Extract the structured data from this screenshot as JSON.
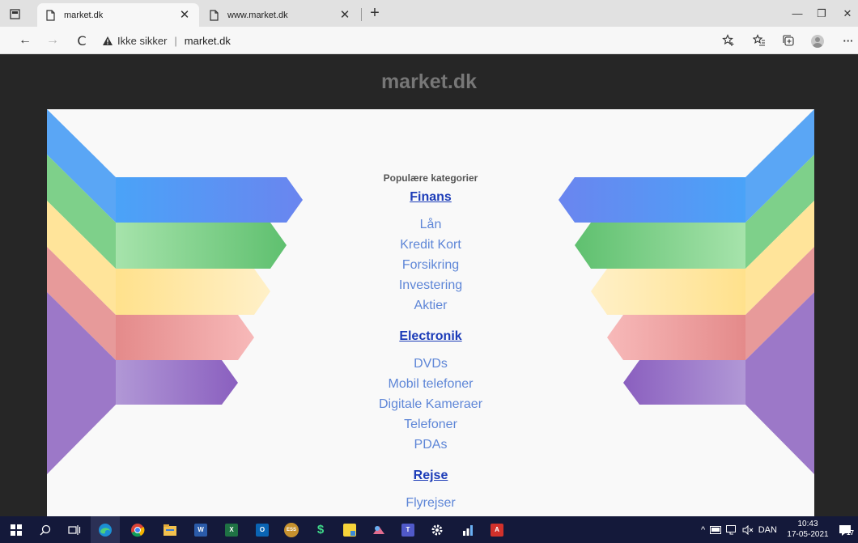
{
  "browser": {
    "tabs": [
      {
        "title": "market.dk",
        "close": "✕",
        "active": true
      },
      {
        "title": "www.market.dk",
        "close": "✕",
        "active": false
      }
    ],
    "new_tab": "+",
    "window_controls": {
      "minimize": "—",
      "restore": "❐",
      "close": "✕"
    },
    "nav": {
      "back": "←",
      "forward": "→",
      "reload": "C"
    },
    "address": {
      "security_label": "Ikke sikker",
      "divider": "|",
      "url": "market.dk"
    },
    "toolbar_icons": [
      "favorite-add-icon",
      "favorites-icon",
      "collections-icon",
      "profile-icon",
      "more-icon"
    ],
    "more": "···"
  },
  "page": {
    "site_title": "market.dk",
    "categories_heading": "Populære kategorier",
    "groups": [
      {
        "title": "Finans",
        "links": [
          "Lån",
          "Kredit Kort",
          "Forsikring",
          "Investering",
          "Aktier"
        ]
      },
      {
        "title": "Electronik",
        "links": [
          "DVDs",
          "Mobil telefoner",
          "Digitale Kameraer",
          "Telefoner",
          "PDAs"
        ]
      },
      {
        "title": "Rejse",
        "links": [
          "Flyrejser"
        ]
      }
    ],
    "ribbon_colors": [
      "#5aa6f5",
      "#6fcc7d",
      "#ffe7a0",
      "#f29a9a",
      "#9f7ccc"
    ]
  },
  "taskbar": {
    "apps": [
      "start-icon",
      "search-icon",
      "task-view-icon",
      "edge-icon",
      "chrome-icon",
      "file-explorer-icon",
      "word-icon",
      "excel-icon",
      "outlook-icon",
      "ess-icon",
      "dollar-app-icon",
      "sticky-notes-icon",
      "snip-icon",
      "teams-icon",
      "settings-icon",
      "chart-app-icon",
      "acrobat-icon"
    ],
    "ess_label": "ESS",
    "tray": {
      "chevron": "^",
      "language": "DAN"
    },
    "clock": {
      "time": "10:43",
      "date": "17-05-2021"
    },
    "notifications_count": "17"
  }
}
